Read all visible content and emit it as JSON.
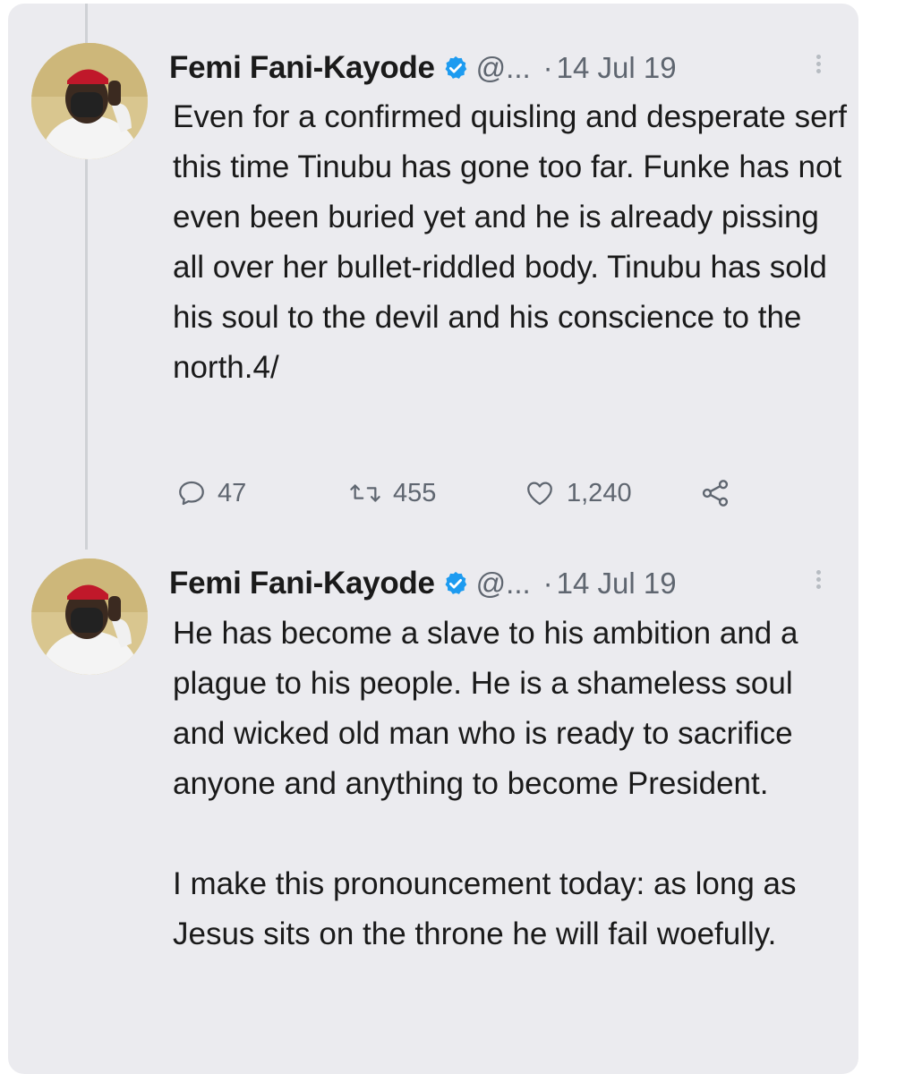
{
  "tweets": [
    {
      "author_name": "Femi Fani-Kayode",
      "handle": "@...",
      "date": "14 Jul 19",
      "separator": "·",
      "paragraphs": [
        "Even for a confirmed quisling and desperate serf this time Tinubu has gone too far. Funke has not even been buried yet and he is already pissing all over her bullet-riddled body. Tinubu has sold his soul to the devil and his conscience to the north.4/"
      ],
      "replies": "47",
      "retweets": "455",
      "likes": "1,240"
    },
    {
      "author_name": "Femi Fani-Kayode",
      "handle": "@...",
      "date": "14 Jul 19",
      "separator": "·",
      "paragraphs": [
        "He has become a slave to his ambition and a plague to his people. He is a shameless soul and wicked old man who is ready to sacrifice anyone and anything to become President.",
        "I make this pronouncement today: as long as Jesus sits on the throne he will fail woefully."
      ]
    }
  ],
  "colors": {
    "card_background": "#ebebef",
    "text": "#1a1a1a",
    "secondary_text": "#5f6670",
    "verified_badge": "#1d9bf0",
    "thread_line": "#cfd1d5"
  },
  "icons": {
    "verified": "verified-badge-icon",
    "more": "more-options-icon",
    "reply": "reply-icon",
    "retweet": "retweet-icon",
    "like": "heart-icon",
    "share": "share-icon"
  }
}
